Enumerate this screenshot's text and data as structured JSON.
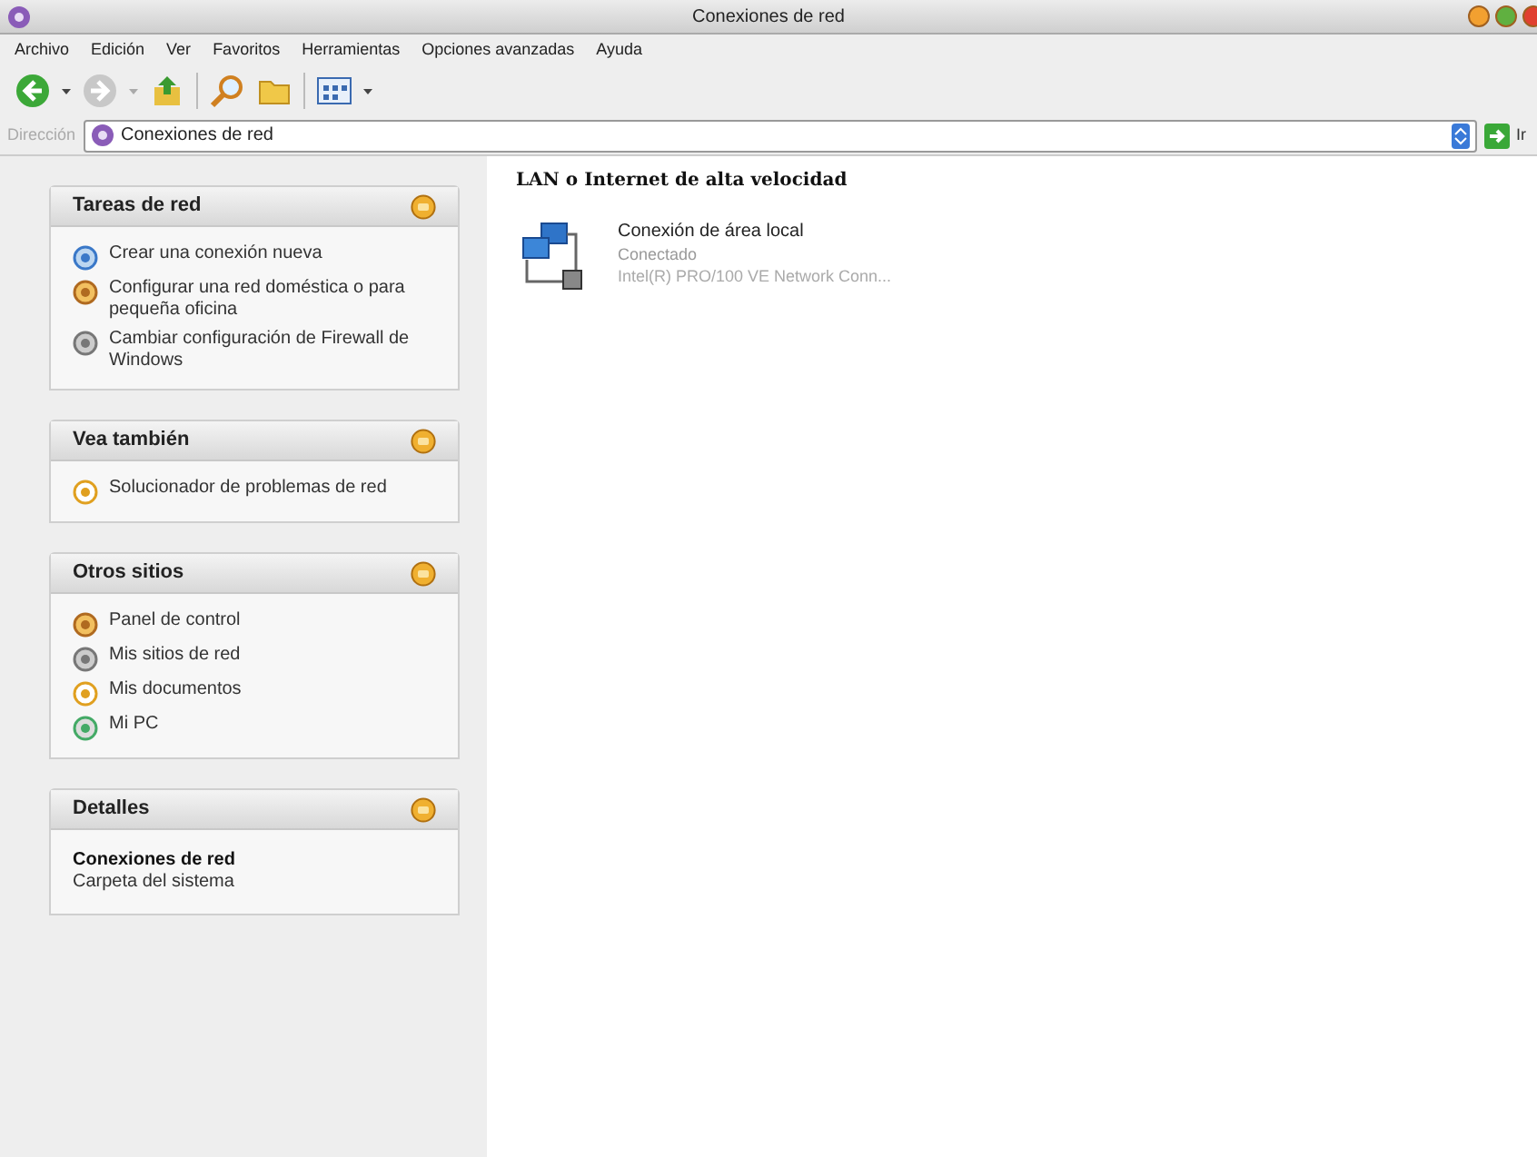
{
  "window": {
    "title": "Conexiones de red"
  },
  "menu": [
    "Archivo",
    "Edición",
    "Ver",
    "Favoritos",
    "Herramientas",
    "Opciones avanzadas",
    "Ayuda"
  ],
  "address": {
    "label": "Dirección",
    "value": "Conexiones de red",
    "go": "Ir"
  },
  "sidebar": {
    "panels": [
      {
        "kind": "links",
        "title": "Tareas de red",
        "items": [
          "Crear una conexión nueva",
          "Configurar una red doméstica o para pequeña oficina",
          "Cambiar configuración de Firewall de Windows"
        ]
      },
      {
        "kind": "links",
        "title": "Vea también",
        "items": [
          "Solucionador de problemas de red"
        ]
      },
      {
        "kind": "links",
        "title": "Otros sitios",
        "items": [
          "Panel de control",
          "Mis sitios de red",
          "Mis documentos",
          "Mi PC"
        ]
      },
      {
        "kind": "details",
        "title": "Detalles",
        "name": "Conexiones de red",
        "description": "Carpeta del sistema"
      }
    ]
  },
  "content": {
    "group": "LAN o Internet de alta velocidad",
    "items": [
      {
        "name": "Conexión de área local",
        "status": "Conectado",
        "device": "Intel(R) PRO/100 VE Network Conn..."
      }
    ]
  }
}
